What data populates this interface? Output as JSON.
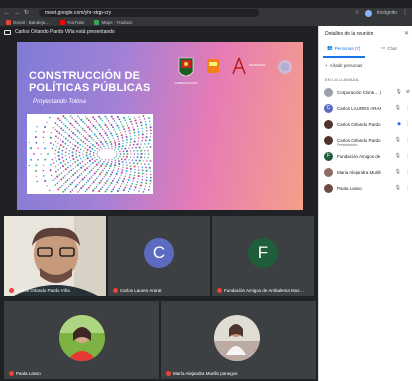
{
  "browser": {
    "url": "meet.google.com/yhr-xtqp-cry",
    "incognito_label": "Incógnito",
    "bookmarks": [
      {
        "label": "Gmail · Bandeja…",
        "color": "#ea4335"
      },
      {
        "label": "YouTube",
        "color": "#ff0000"
      },
      {
        "label": "Maps · Traducir",
        "color": "#34a853"
      }
    ]
  },
  "meet": {
    "presenting_text": "Carlos Orlando Pardo Viña está presentando",
    "slide": {
      "title_line1": "CONSTRUCCIÓN DE",
      "title_line2": "POLÍTICAS PÚBLICAS",
      "subtitle": "Proyectando Tolima",
      "logo_text": "GOBERNACIÓN DEL TOLIMA"
    },
    "tiles": [
      {
        "name": "Carlos Orlando Pardo Viña",
        "kind": "video"
      },
      {
        "name": "Carlos Lauren Ararat",
        "letter": "C",
        "color": "#5c6bc0"
      },
      {
        "name": "Fundación Amigos de Ambalema Mus…",
        "letter": "F",
        "color": "#1e5e3b"
      },
      {
        "name": "Paola Lasso",
        "kind": "photo"
      },
      {
        "name": "María Alejandra Murillo panegos",
        "kind": "photo"
      }
    ]
  },
  "panel": {
    "title": "Detalles de la reunión",
    "tab_people": "Personas (7)",
    "tab_chat": "Chat",
    "add_people": "Añadir personas",
    "section_label": "EN LA LLAMADA",
    "participants": [
      {
        "name": "Corporación Cisne… (Tú)",
        "color": "#9aa0a6",
        "letter": ""
      },
      {
        "name": "Carlos LAURES ARARAT",
        "color": "#5c6bc0",
        "letter": "C"
      },
      {
        "name": "Carlos Orlando Pardo Viña",
        "color": "#4e342e",
        "letter": ""
      },
      {
        "name": "Carlos Orlando Pardo Viña",
        "color": "#4e342e",
        "letter": "",
        "sub": "Presentación"
      },
      {
        "name": "Fundación Amigos de Am…",
        "color": "#1e5e3b",
        "letter": "F"
      },
      {
        "name": "Maria Alejandra Murillo p…",
        "color": "#8d6e63",
        "letter": ""
      },
      {
        "name": "Paola Lasso",
        "color": "#6d4c41",
        "letter": ""
      }
    ]
  }
}
